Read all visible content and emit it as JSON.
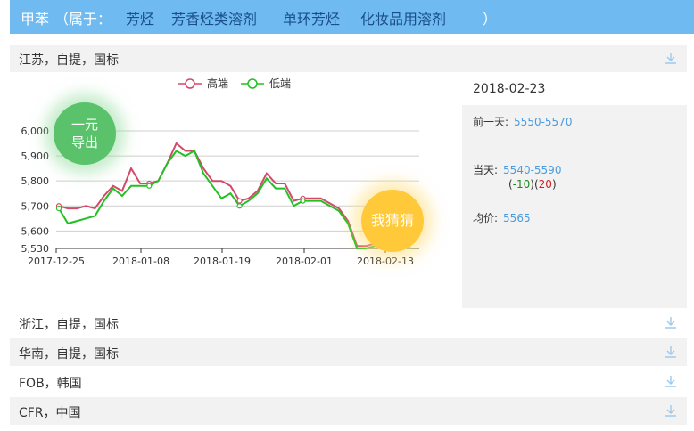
{
  "header": {
    "product": "甲苯",
    "belongs_open": "（属于：",
    "categories": [
      "芳烃",
      "芳香烃类溶剂",
      "单环芳烃",
      "化妆品用溶剂"
    ],
    "belongs_close": "）"
  },
  "regions": [
    {
      "label": "江苏，自提，国标",
      "expanded": true
    },
    {
      "label": "浙江，自提，国标",
      "expanded": false
    },
    {
      "label": "华南，自提，国标",
      "expanded": false
    },
    {
      "label": "FOB，韩国",
      "expanded": false
    },
    {
      "label": "CFR，中国",
      "expanded": false
    }
  ],
  "price_panel": {
    "date": "2018-02-23",
    "prev_day_label": "前一天:",
    "prev_day_value": "5550-5570",
    "today_label": "当天:",
    "today_value": "5540-5590",
    "change_low": "-10",
    "change_high": "20",
    "avg_label": "均价:",
    "avg_value": "5565"
  },
  "badges": {
    "export_line1": "一元",
    "export_line2": "导出",
    "guess": "我猜猜"
  },
  "colors": {
    "header_bg": "#6fbaf0",
    "high_line": "#d14a6a",
    "low_line": "#22c022",
    "link_blue": "#4a9be0"
  },
  "chart_data": {
    "type": "line",
    "x_ticks": [
      "2017-12-25",
      "2018-01-08",
      "2018-01-19",
      "2018-02-01",
      "2018-02-13"
    ],
    "y_ticks": [
      6000,
      5900,
      5800,
      5700,
      5600,
      5530
    ],
    "ylim": [
      5530,
      6000
    ],
    "grid": true,
    "legend_position": "top",
    "series": [
      {
        "name": "高端",
        "color": "#d14a6a",
        "values": [
          5700,
          5690,
          5690,
          5700,
          5690,
          5740,
          5780,
          5760,
          5850,
          5790,
          5790,
          5800,
          5870,
          5950,
          5920,
          5920,
          5850,
          5800,
          5800,
          5780,
          5720,
          5730,
          5760,
          5830,
          5790,
          5790,
          5720,
          5730,
          5730,
          5730,
          5710,
          5690,
          5640,
          5540,
          5540,
          5550,
          5550,
          5550,
          5550,
          5560
        ]
      },
      {
        "name": "低端",
        "color": "#22c022",
        "values": [
          5690,
          5630,
          5640,
          5650,
          5660,
          5720,
          5770,
          5740,
          5780,
          5780,
          5780,
          5800,
          5870,
          5920,
          5900,
          5920,
          5830,
          5780,
          5730,
          5750,
          5700,
          5720,
          5750,
          5810,
          5770,
          5770,
          5700,
          5720,
          5720,
          5720,
          5700,
          5680,
          5630,
          5530,
          5530,
          5540,
          5540,
          5540,
          5540,
          5530
        ]
      }
    ]
  }
}
